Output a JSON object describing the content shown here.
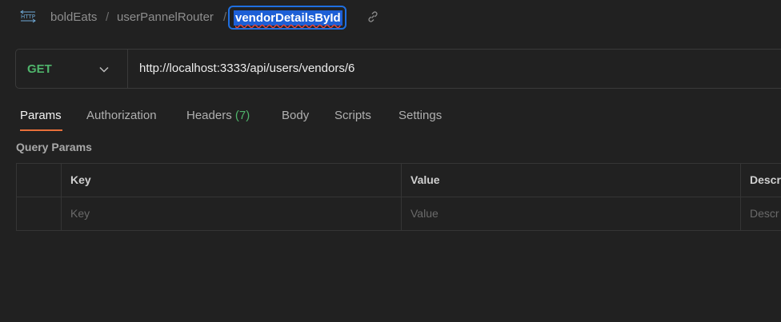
{
  "breadcrumb": {
    "method_badge": "HTTP",
    "items": [
      "boldEats",
      "userPannelRouter"
    ],
    "separator": "/",
    "request_name": "vendorDetailsById"
  },
  "request": {
    "method": "GET",
    "url": "http://localhost:3333/api/users/vendors/6"
  },
  "tabs": [
    {
      "label": "Params",
      "active": true
    },
    {
      "label": "Authorization"
    },
    {
      "label": "Headers",
      "count": "(7)"
    },
    {
      "label": "Body"
    },
    {
      "label": "Scripts"
    },
    {
      "label": "Settings"
    }
  ],
  "query_params": {
    "title": "Query Params",
    "columns": [
      "Key",
      "Value",
      "Descr"
    ],
    "placeholders": [
      "Key",
      "Value",
      "Descr"
    ]
  },
  "colors": {
    "background": "#212121",
    "method_get": "#4fb46b",
    "active_tab_underline": "#e8703a",
    "name_edit_border": "#1f6fe0",
    "selection": "#1d5fd6"
  },
  "icons": [
    "http-icon",
    "link-icon",
    "chevron-down-icon"
  ]
}
